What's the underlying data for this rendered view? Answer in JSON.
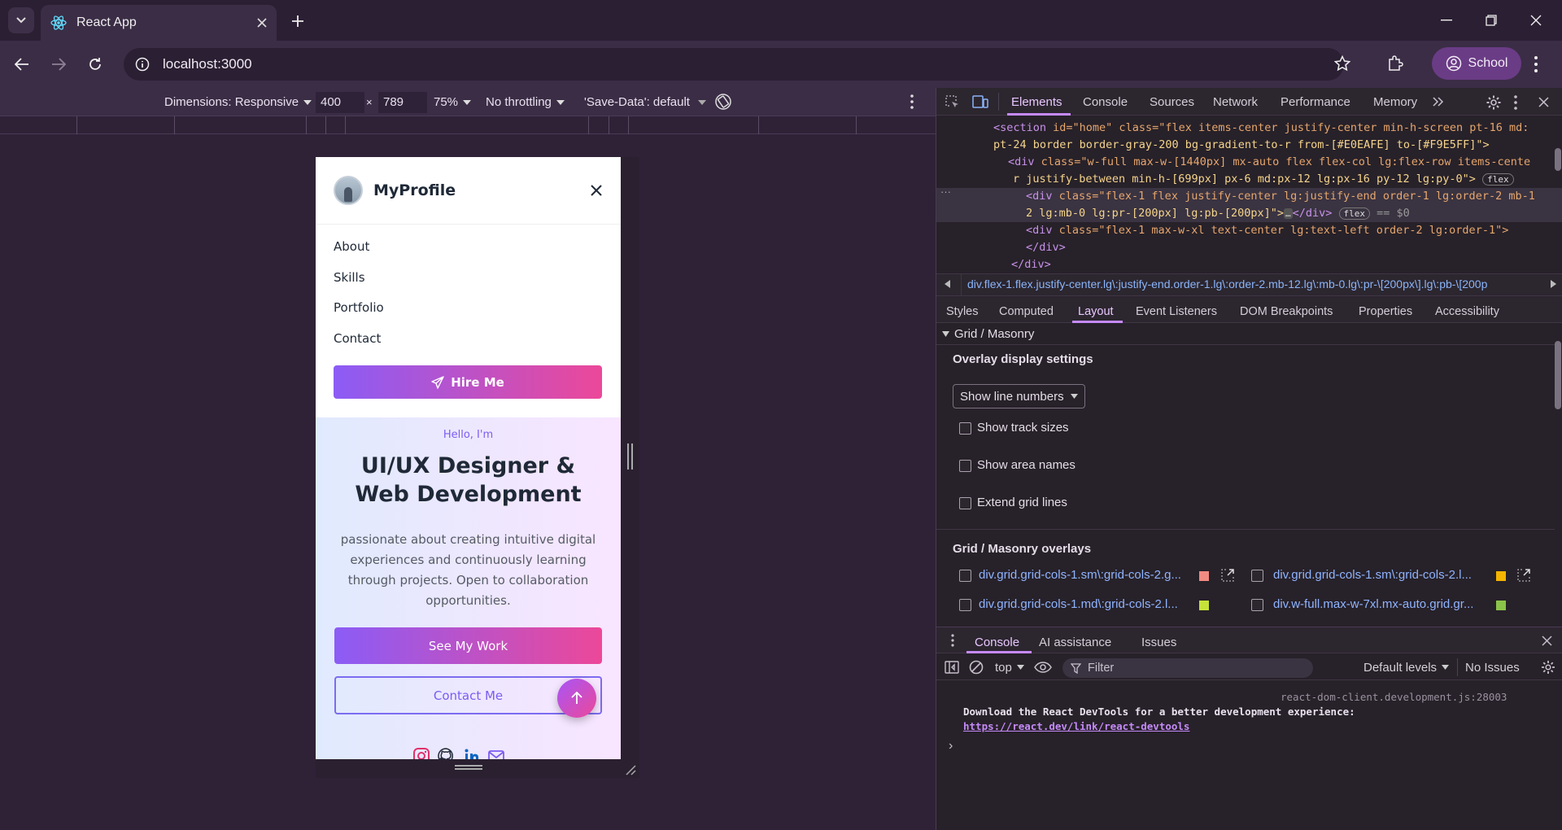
{
  "browser": {
    "tab_title": "React App",
    "url": "localhost:3000",
    "profile_label": "School"
  },
  "device_toolbar": {
    "dimensions_label": "Dimensions: Responsive",
    "width": "400",
    "times": "×",
    "height": "789",
    "zoom": "75%",
    "throttling": "No throttling",
    "save_data": "'Save-Data': default"
  },
  "page": {
    "brand": "MyProfile",
    "nav": [
      "About",
      "Skills",
      "Portfolio",
      "Contact"
    ],
    "hire_button": "Hire Me",
    "hello": "Hello, I'm",
    "headline_line1": "UI/UX Designer &",
    "headline_line2": "Web Development",
    "tagline": "passionate about creating intuitive digital experiences and continuously learning through projects. Open to collaboration opportunities.",
    "primary_button": "See My Work",
    "secondary_button": "Contact Me"
  },
  "devtools": {
    "main_tabs": [
      "Elements",
      "Console",
      "Sources",
      "Network",
      "Performance",
      "Memory"
    ],
    "dom_lines": {
      "l1_tag": "<section",
      "l1_attrs": " id=\"home\" class=\"flex items-center justify-center min-h-screen pt-16 md:",
      "l2": "pt-24 border border-gray-200 bg-gradient-to-r from-[#E0EAFE] to-[#F9E5FF]\">",
      "l3_tag": "<div",
      "l3_attrs": " class=\"w-full max-w-[1440px] mx-auto flex flex-col lg:flex-row items-cente",
      "l4": "r justify-between min-h-[699px] px-6 md:px-12 lg:px-16 py-12 lg:py-0\">",
      "l4_badge": "flex",
      "l5_tag": "<div",
      "l5_attrs": " class=\"flex-1 flex justify-center lg:justify-end order-1 lg:order-2 mb-1",
      "l6": "2 lg:mb-0 lg:pr-[200px] lg:pb-[200px]\">",
      "l6_close": "</div>",
      "l6_badge": "flex",
      "l6_sel": "== $0",
      "l7_tag": "<div",
      "l7_attrs": " class=\"flex-1 max-w-xl text-center lg:text-left order-2 lg:order-1\">",
      "l8": "</div>",
      "l9": "</div>"
    },
    "breadcrumb": "div.flex-1.flex.justify-center.lg\\:justify-end.order-1.lg\\:order-2.mb-12.lg\\:mb-0.lg\\:pr-\\[200px\\].lg\\:pb-\\[200p",
    "sub_tabs": [
      "Styles",
      "Computed",
      "Layout",
      "Event Listeners",
      "DOM Breakpoints",
      "Properties",
      "Accessibility"
    ],
    "section_title": "Grid / Masonry",
    "overlay_title": "Overlay display settings",
    "select_value": "Show line numbers",
    "checkboxes": [
      "Show track sizes",
      "Show area names",
      "Extend grid lines"
    ],
    "overlays_title": "Grid / Masonry overlays",
    "overlays": [
      {
        "label": "div.grid.grid-cols-1.sm\\:grid-cols-2.g...",
        "color": "#f28b82"
      },
      {
        "label": "div.grid.grid-cols-1.sm\\:grid-cols-2.l...",
        "color": "#f4b400"
      },
      {
        "label": "div.grid.grid-cols-1.md\\:grid-cols-2.l...",
        "color": "#c6e33a"
      },
      {
        "label": "div.w-full.max-w-7xl.mx-auto.grid.gr...",
        "color": "#8bc34a"
      }
    ],
    "drawer_tabs": [
      "Console",
      "AI assistance",
      "Issues"
    ],
    "console_context": "top",
    "filter_placeholder": "Filter",
    "levels": "Default levels",
    "issues": "No Issues",
    "log_source": "react-dom-client.development.js:28003",
    "log_message": "Download the React DevTools for a better development experience:",
    "log_link": "https://react.dev/link/react-devtools",
    "prompt": "›"
  }
}
